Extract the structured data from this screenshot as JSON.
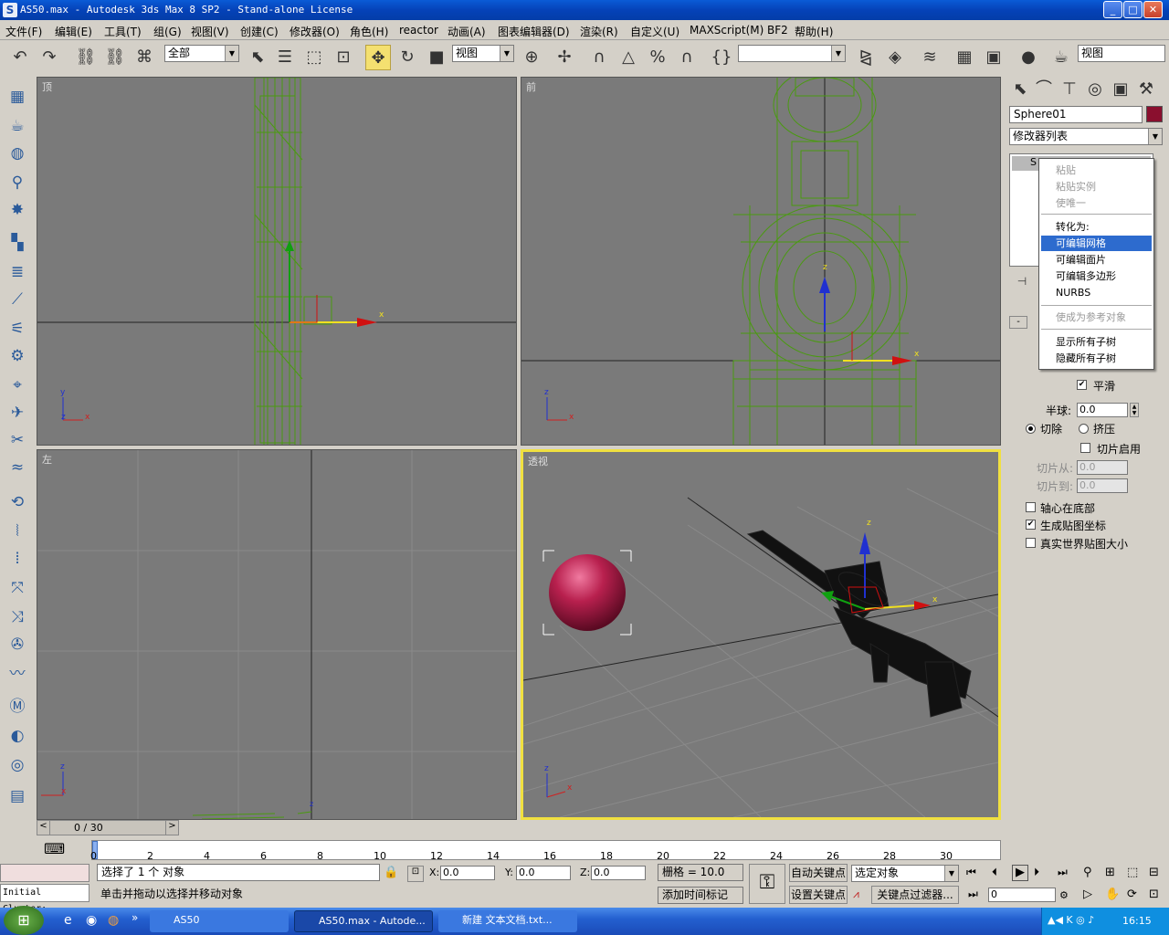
{
  "window": {
    "title": "AS50.max - Autodesk 3ds Max 8 SP2  - Stand-alone License",
    "app_icon": "3ds-max-icon",
    "controls": [
      "_",
      "□",
      "✕"
    ]
  },
  "menu": [
    "文件(F)",
    "编辑(E)",
    "工具(T)",
    "组(G)",
    "视图(V)",
    "创建(C)",
    "修改器(O)",
    "角色(H)",
    "reactor",
    "动画(A)",
    "图表编辑器(D)",
    "渲染(R)",
    "自定义(U)",
    "MAXScript(M)",
    "BF2",
    "帮助(H)"
  ],
  "toolbar": {
    "selection_filter": "全部",
    "ref_coord": "视图",
    "named_selection": "",
    "views_dropdown": "视图"
  },
  "viewports": {
    "top": "顶",
    "front": "前",
    "left": "左",
    "perspective": "透视"
  },
  "axes": {
    "x": "x",
    "y": "y",
    "z": "z"
  },
  "command_panel": {
    "object_name": "Sphere01",
    "object_color": "#8a0f2e",
    "modifier_list": "修改器列表",
    "stack_item": "S",
    "context_menu": [
      {
        "label": "粘贴",
        "state": "disabled"
      },
      {
        "label": "粘贴实例",
        "state": "disabled"
      },
      {
        "label": "使唯一",
        "state": "disabled"
      },
      {
        "label": "转化为:",
        "state": "normal"
      },
      {
        "label": "可编辑网格",
        "state": "highlighted"
      },
      {
        "label": "可编辑面片",
        "state": "normal"
      },
      {
        "label": "可编辑多边形",
        "state": "normal"
      },
      {
        "label": "NURBS",
        "state": "normal"
      },
      {
        "label": "使成为参考对象",
        "state": "disabled"
      },
      {
        "label": "显示所有子树",
        "state": "normal"
      },
      {
        "label": "隐藏所有子树",
        "state": "normal"
      }
    ],
    "smooth_label": "平滑",
    "smooth_checked": true,
    "hemisphere_label": "半球:",
    "hemisphere_value": "0.0",
    "chop_label": "切除",
    "squash_label": "挤压",
    "slice_on_label": "切片启用",
    "slice_from_label": "切片从:",
    "slice_from_value": "0.0",
    "slice_to_label": "切片到:",
    "slice_to_value": "0.0",
    "base_to_pivot_label": "轴心在底部",
    "gen_map_label": "生成贴图坐标",
    "real_world_label": "真实世界贴图大小",
    "rollout_minus": "-"
  },
  "timeline": {
    "frame_display": "0 / 30",
    "ticks": [
      "0",
      "2",
      "4",
      "6",
      "8",
      "10",
      "12",
      "14",
      "16",
      "18",
      "20",
      "22",
      "24",
      "26",
      "28",
      "30"
    ],
    "progress": 0.0
  },
  "status": {
    "selected": "选择了 1 个 对象",
    "prompt": "单击并拖动以选择并移动对象",
    "x_label": "X:",
    "x": "0.0",
    "y_label": "Y:",
    "y": "0.0",
    "z_label": "Z:",
    "z": "0.0",
    "grid": "栅格 = 10.0",
    "add_time_tag": "添加时间标记",
    "auto_key": "自动关键点",
    "set_key": "设置关键点",
    "key_filter": "关键点过滤器...",
    "selected_object": "选定对象",
    "frame_field": "0",
    "maxscript_listener": "Initial Cluster:"
  },
  "taskbar": {
    "items": [
      "AS50",
      "AS50.max - Autode...",
      "新建 文本文档.txt..."
    ],
    "clock": "16:15"
  }
}
